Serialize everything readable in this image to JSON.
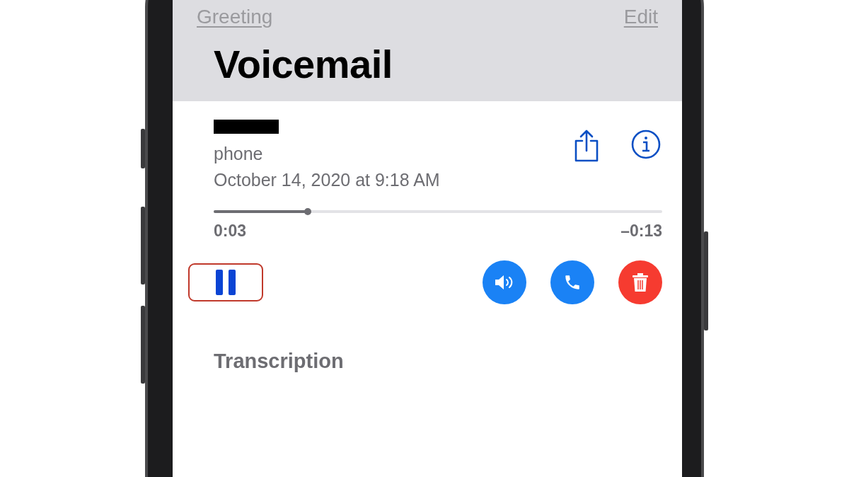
{
  "nav": {
    "left": "Greeting",
    "right": "Edit"
  },
  "title": "Voicemail",
  "message": {
    "caller_redacted": true,
    "label": "phone",
    "date": "October 14, 2020 at 9:18 AM"
  },
  "playback": {
    "level": 0.21,
    "elapsed": "0:03",
    "remaining": "–0:13",
    "playing": true
  },
  "actions": [
    {
      "kind": "speaker"
    },
    {
      "kind": "call"
    },
    {
      "kind": "delete"
    }
  ],
  "transcription": {
    "heading": "Transcription"
  }
}
